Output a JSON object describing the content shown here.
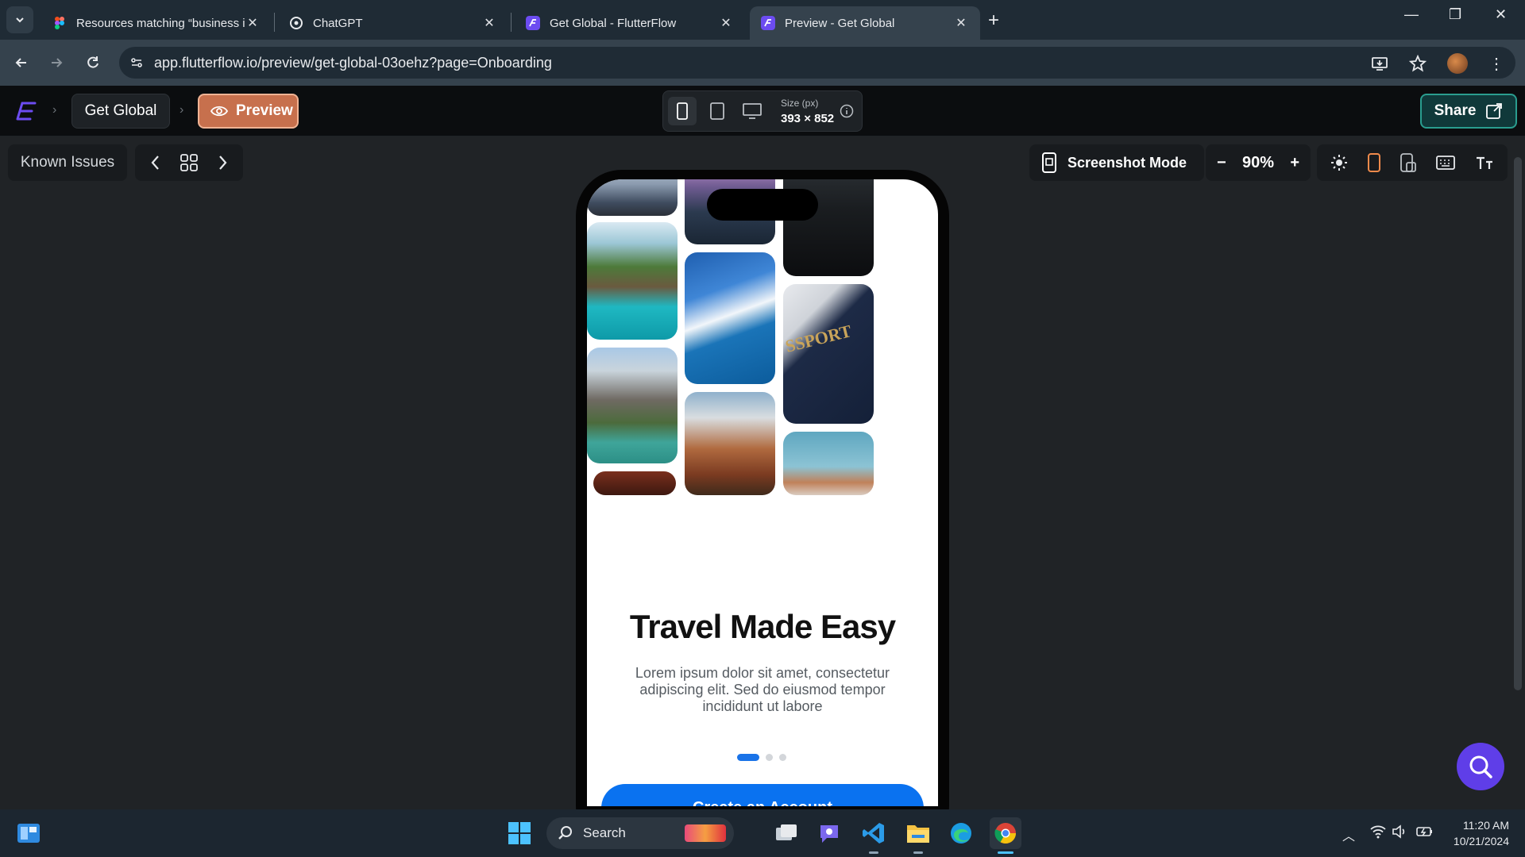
{
  "browser": {
    "tabs": [
      {
        "title": "Resources matching “business i",
        "active": false
      },
      {
        "title": "ChatGPT",
        "active": false
      },
      {
        "title": "Get Global - FlutterFlow",
        "active": false
      },
      {
        "title": "Preview - Get Global",
        "active": true
      }
    ],
    "url": "app.flutterflow.io/preview/get-global-03oehz?page=Onboarding"
  },
  "header": {
    "project_name": "Get Global",
    "preview_label": "Preview",
    "size_label": "Size (px)",
    "size_value": "393 × 852",
    "share_label": "Share"
  },
  "canvas_toolbar": {
    "known_issues_label": "Known Issues",
    "screenshot_mode_label": "Screenshot Mode",
    "zoom_value": "90%"
  },
  "onboarding": {
    "title": "Travel Made Easy",
    "body": "Lorem ipsum dolor sit amet, consectetur adipiscing elit. Sed do eiusmod tempor incididunt ut labore",
    "page_count": 3,
    "current_page": 1,
    "cta_label": "Create an Account"
  },
  "taskbar": {
    "search_label": "Search",
    "time": "11:20 AM",
    "date": "10/21/2024"
  },
  "colors": {
    "preview_accent": "#c7704d",
    "share_accent": "#2a9d8f",
    "cta_blue": "#0a72f0",
    "fab_purple": "#5f3ee8"
  }
}
